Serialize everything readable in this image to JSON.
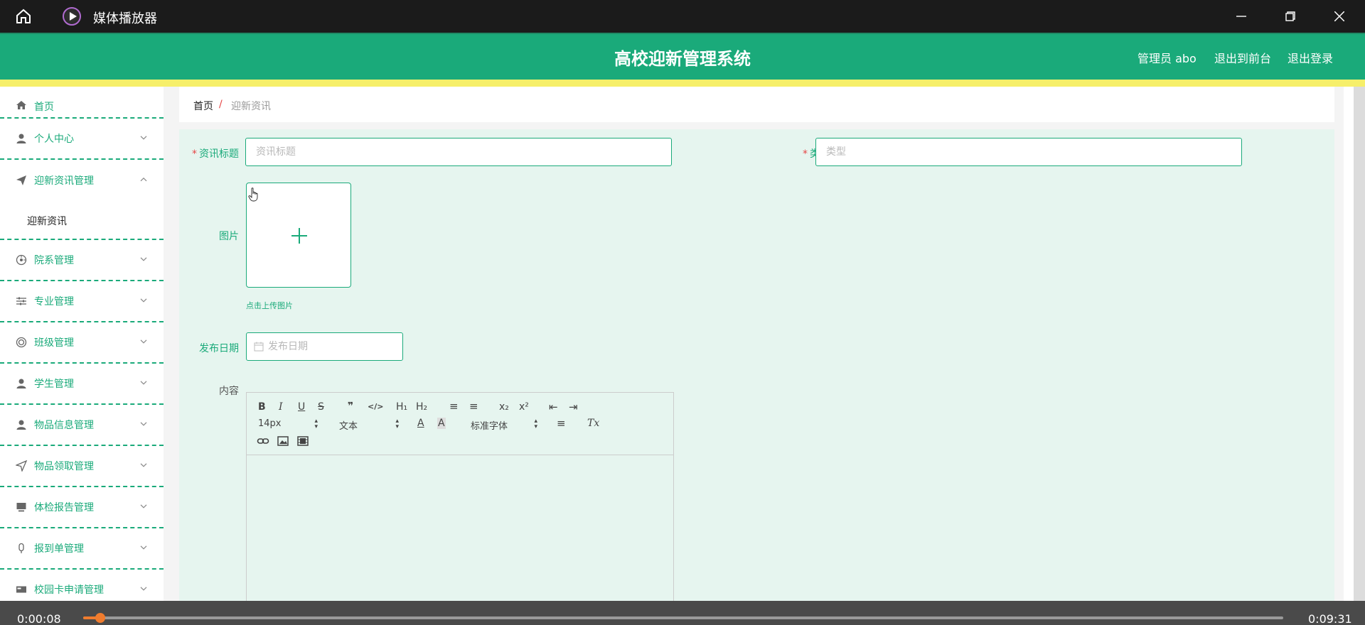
{
  "player": {
    "title": "媒体播放器",
    "time_current": "0:00:08",
    "time_total": "0:09:31",
    "progress_fraction": 0.014
  },
  "header": {
    "system_title": "高校迎新管理系统",
    "admin_label": "管理员 abo",
    "to_frontend": "退出到前台",
    "logout": "退出登录"
  },
  "sidebar": {
    "items": [
      {
        "label": "首页",
        "icon": "home-icon"
      },
      {
        "label": "个人中心",
        "icon": "person-icon"
      },
      {
        "label": "迎新资讯管理",
        "icon": "paper-plane-icon",
        "expanded": true,
        "children": [
          "迎新资讯"
        ]
      },
      {
        "label": "院系管理",
        "icon": "dial-icon"
      },
      {
        "label": "专业管理",
        "icon": "sliders-icon"
      },
      {
        "label": "班级管理",
        "icon": "ring-icon"
      },
      {
        "label": "学生管理",
        "icon": "person-icon"
      },
      {
        "label": "物品信息管理",
        "icon": "person-icon"
      },
      {
        "label": "物品领取管理",
        "icon": "send-icon"
      },
      {
        "label": "体检报告管理",
        "icon": "monitor-icon"
      },
      {
        "label": "报到单管理",
        "icon": "mic-icon"
      },
      {
        "label": "校园卡申请管理",
        "icon": "card-icon"
      }
    ]
  },
  "breadcrumb": {
    "home": "首页",
    "separator": "/",
    "current": "迎新资讯"
  },
  "form": {
    "title_label": "资讯标题",
    "title_placeholder": "资讯标题",
    "type_label": "类型",
    "type_placeholder": "类型",
    "image_label": "图片",
    "upload_hint": "点击上传图片",
    "date_label": "发布日期",
    "date_placeholder": "发布日期",
    "content_label": "内容",
    "required_mark": "*"
  },
  "editor": {
    "font_size": "14px",
    "text_style": "文本",
    "font_family": "标准字体",
    "buttons": {
      "bold": "B",
      "italic": "I",
      "underline": "U",
      "strike": "S",
      "quote": "❞",
      "code": "</>",
      "h1": "H₁",
      "h2": "H₂",
      "ordered": "≡",
      "bullet": "≡",
      "sub": "x₂",
      "sup": "x²",
      "outdent": "⇤",
      "indent": "⇥",
      "font_color": "A",
      "bg_color": "A",
      "align": "≡",
      "clean": "Tx"
    }
  },
  "colors": {
    "accent": "#1aaa7a",
    "yellow_bar": "#f6ef6a",
    "progress": "#f07c2e",
    "required": "#e64545"
  }
}
